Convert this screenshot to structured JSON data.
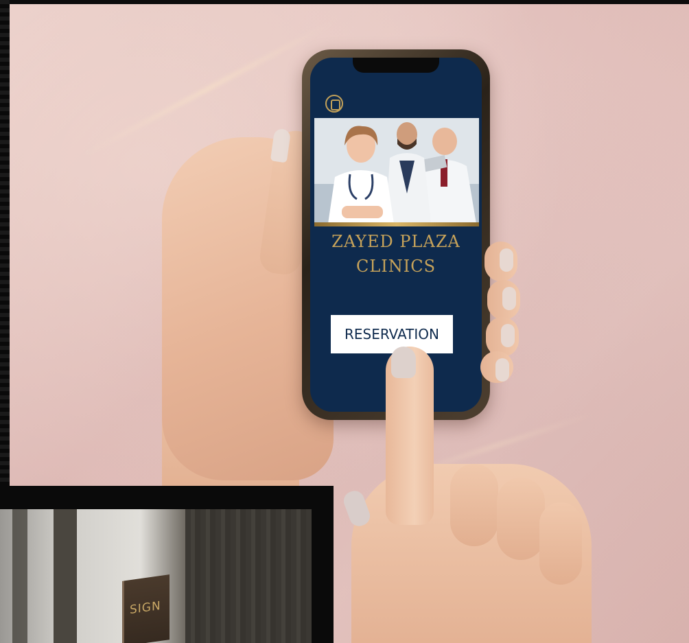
{
  "phone_app": {
    "clinic_name_line1": "ZAYED PLAZA",
    "clinic_name_line2": "CLINICS",
    "reservation_button_label": "RESERVATION",
    "colors": {
      "screen_background": "#0e2a4d",
      "accent_gold": "#c7a35a",
      "button_background": "#ffffff"
    },
    "icons": {
      "logo": "clinic-logo-icon",
      "hero": "doctors-photo"
    }
  },
  "inset_photo": {
    "sign_text": "SIGN"
  }
}
